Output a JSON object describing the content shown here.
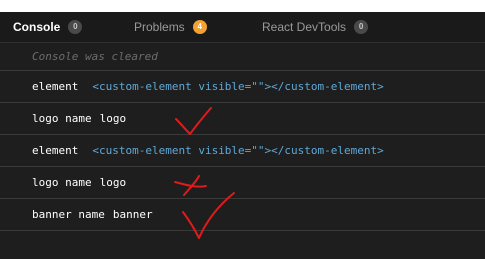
{
  "tabs": [
    {
      "label": "Console",
      "badge": "0",
      "active": true
    },
    {
      "label": "Problems",
      "badge": "4",
      "active": false
    },
    {
      "label": "React DevTools",
      "badge": "0",
      "active": false
    }
  ],
  "console": {
    "cleared_message": "Console was cleared",
    "rows": [
      {
        "key": "element",
        "value": "<custom-element visible=\"\"></custom-element>"
      },
      {
        "key": "logo name",
        "value": "logo"
      },
      {
        "key": "element",
        "value": "<custom-element visible=\"\"></custom-element>"
      },
      {
        "key": "logo name",
        "value": "logo"
      },
      {
        "key": "banner name",
        "value": "banner"
      }
    ]
  },
  "colors": {
    "background": "#1e1e1e",
    "tag_value": "#5fa8d8",
    "problems_badge": "#f2a132",
    "annotation": "#e01b1b"
  },
  "annotations": [
    "checkmark",
    "cross",
    "checkmark"
  ]
}
